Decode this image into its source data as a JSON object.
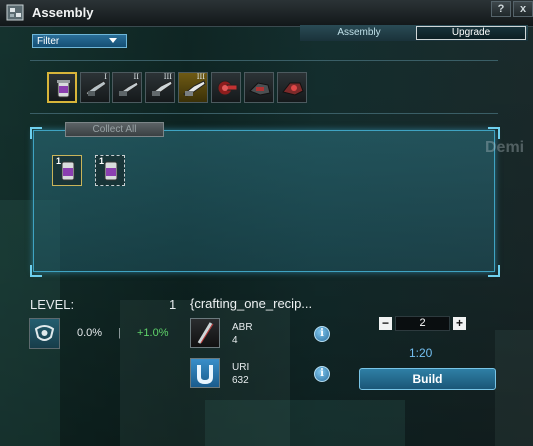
{
  "window": {
    "title": "Assembly",
    "help_label": "?",
    "close_label": "x"
  },
  "tabs": [
    {
      "label": "Assembly",
      "active": false
    },
    {
      "label": "Upgrade",
      "active": true
    }
  ],
  "filter": {
    "label": "Filter"
  },
  "categories": [
    {
      "icon": "canister-icon",
      "tier": "",
      "selected": true
    },
    {
      "icon": "turret-icon",
      "tier": "I",
      "selected": false
    },
    {
      "icon": "turret-icon",
      "tier": "II",
      "selected": false
    },
    {
      "icon": "turret-icon",
      "tier": "III",
      "selected": false
    },
    {
      "icon": "turret-icon",
      "tier": "III",
      "selected": false,
      "highlight": true
    },
    {
      "icon": "red-device-icon",
      "tier": "",
      "selected": false
    },
    {
      "icon": "ship-icon",
      "tier": "",
      "selected": false
    },
    {
      "icon": "red-ship-icon",
      "tier": "",
      "selected": false
    }
  ],
  "collection": {
    "collect_all_label": "Collect All",
    "slots": [
      {
        "count": "1"
      },
      {
        "count": "1"
      }
    ]
  },
  "background_text": "Demi",
  "level": {
    "label": "LEVEL:",
    "value": "1",
    "progress": "0.0%",
    "separator": "|",
    "gain": "+1.0%"
  },
  "recipe": {
    "title": "{crafting_one_recip...",
    "materials": [
      {
        "name": "ABR",
        "quantity": "4",
        "icon": "rod-icon"
      },
      {
        "name": "URI",
        "quantity": "632",
        "icon": "uri-resource-icon"
      }
    ],
    "info_label": "i"
  },
  "build": {
    "quantity": "2",
    "minus_label": "−",
    "plus_label": "+",
    "time": "1:20",
    "button_label": "Build"
  },
  "colors": {
    "accent": "#3fa3c2",
    "gain": "#5fd36a",
    "time": "#74bff0"
  }
}
